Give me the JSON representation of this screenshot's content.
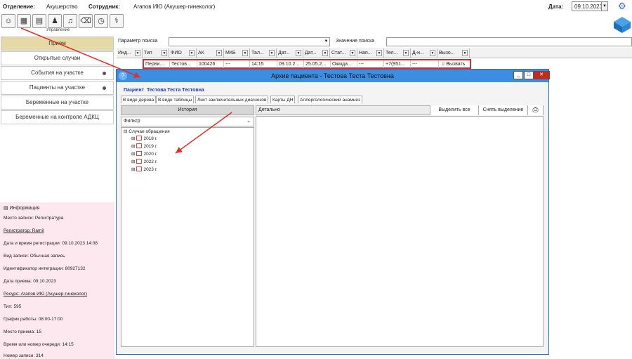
{
  "header": {
    "dept_label": "Отделение:",
    "dept_value": "Акушерство",
    "employee_label": "Сотрудник:",
    "employee_value": "Агапов ИЮ (Акушер-гинеколог)",
    "date_label": "Дата:",
    "date_value": "09.10.2023"
  },
  "toolbar": {
    "group_label": "Управление"
  },
  "sidebar": {
    "items": [
      {
        "label": "Прием"
      },
      {
        "label": "Открытые случаи"
      },
      {
        "label": "События на участке"
      },
      {
        "label": "Пациенты на участке"
      },
      {
        "label": "Беременные на участке"
      },
      {
        "label": "Беременные на контроле АДКЦ"
      }
    ]
  },
  "info": {
    "title": "Информация",
    "rows": [
      "Место записи: Регистратура",
      "Регистратор: Ramil",
      "Дата и время регистрации: 09.10.2023 14:08",
      "Вид записи: Обычная запись",
      "Идентификатор интеграции: 80927132",
      "Дата приема: 09.10.2023",
      "Ресурс: Агапов ИЮ (Акушер-гинеколог)",
      "Тип: 595",
      "График работы: 08:00-17:00",
      "Место приема: 15",
      "Время или номер очереди: 14:15",
      "Номер записи: 314"
    ]
  },
  "search": {
    "param_label": "Параметр поиска",
    "value_label": "Значение поиска"
  },
  "grid": {
    "headers": [
      "Инд...",
      "Тип",
      "ФИО",
      "АК",
      "МКБ",
      "Тал...",
      "Дат...",
      "Дат...",
      "Стат...",
      "Нап...",
      "Тел...",
      "Д-н...",
      "Вызо..."
    ],
    "row": [
      "Перви...",
      "Тестов...",
      "100426",
      "---",
      "14:15",
      "09.10.2...",
      "25.05.2...",
      "Ожида...",
      "---",
      "+7(951...",
      "---",
      "Вызвать"
    ]
  },
  "modal": {
    "title": "Архив пациента - Тестова Теста Тестовна",
    "patient_label": "Пациент",
    "patient_name": "Тестова Теста Тестовна",
    "tabs": [
      "В виде дерева",
      "В виде таблицы",
      "Лист заключительных диагнозов",
      "Карты ДН",
      "Аллергологический анамнез"
    ],
    "history_label": "История",
    "filter_label": "Фильтр",
    "detail_label": "Детально",
    "select_all": "Выделить все",
    "deselect": "Снять выделение",
    "tree_root": "Случаи обращения",
    "years": [
      "2018 г.",
      "2019 г.",
      "2020 г.",
      "2022 г.",
      "2023 г."
    ]
  },
  "colors": {
    "accent": "#3d8ee0",
    "highlight": "#d62b2b",
    "active_nav": "#e6d9a6",
    "info_bg": "#fde8ef"
  }
}
